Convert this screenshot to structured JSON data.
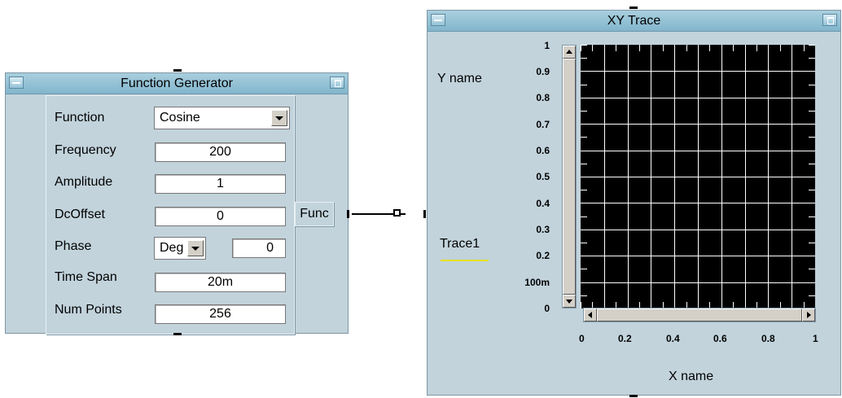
{
  "function_generator": {
    "title": "Function Generator",
    "fields": {
      "function": {
        "label": "Function",
        "value": "Cosine"
      },
      "frequency": {
        "label": "Frequency",
        "value": "200"
      },
      "amplitude": {
        "label": "Amplitude",
        "value": "1"
      },
      "dcoffset": {
        "label": "DcOffset",
        "value": "0"
      },
      "phase": {
        "label": "Phase",
        "unit": "Deg",
        "value": "0"
      },
      "time_span": {
        "label": "Time Span",
        "value": "20m"
      },
      "num_points": {
        "label": "Num Points",
        "value": "256"
      }
    },
    "output_pin": "Func"
  },
  "xy_trace": {
    "title": "XY Trace",
    "y_name": "Y name",
    "x_name": "X name",
    "trace_label": "Trace1",
    "trace_color": "#e8e000",
    "y_ticks": [
      "1",
      "0.9",
      "0.8",
      "0.7",
      "0.6",
      "0.5",
      "0.4",
      "0.3",
      "0.2",
      "100m",
      "0"
    ],
    "x_ticks": [
      "0",
      "0.2",
      "0.4",
      "0.6",
      "0.8",
      "1"
    ]
  },
  "colors": {
    "window_bg": "#c2d3dc",
    "titlebar": "#95c3d6",
    "plot_bg": "#000000",
    "grid": "#ffffff"
  }
}
